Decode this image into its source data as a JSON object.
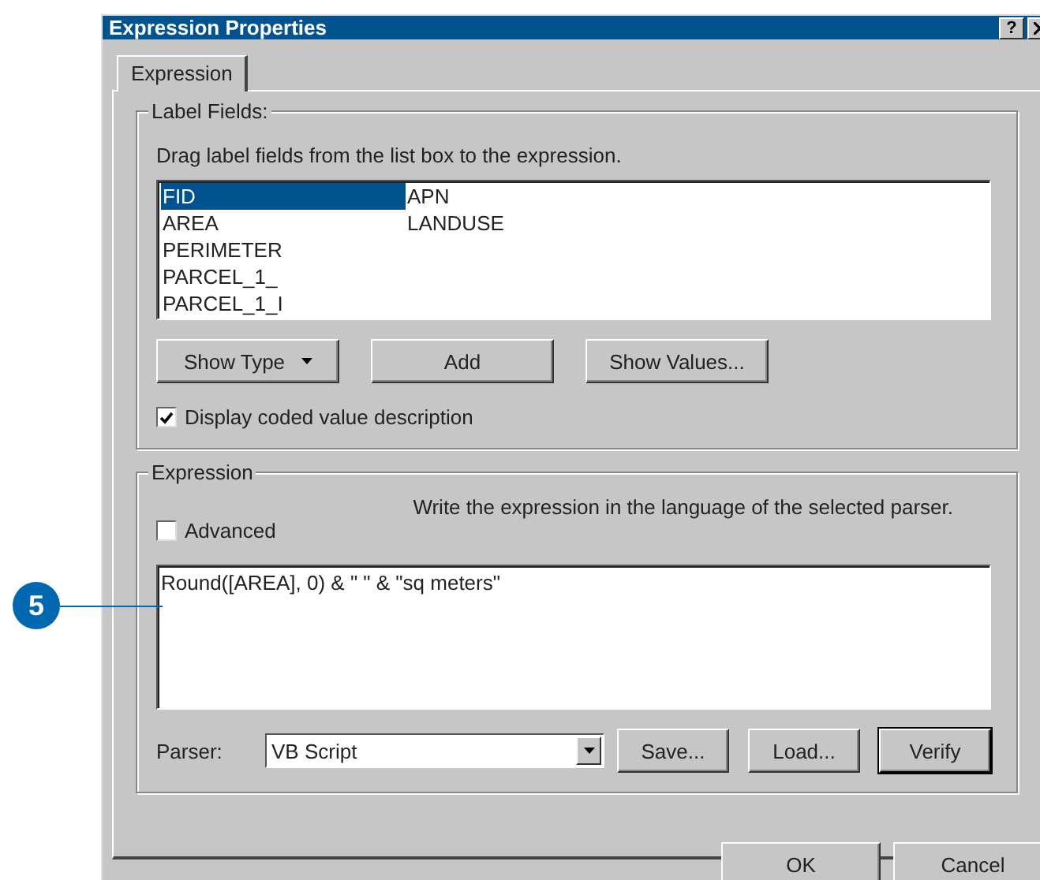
{
  "window": {
    "title": "Expression Properties",
    "help_button": "?"
  },
  "tabs": [
    {
      "label": "Expression",
      "selected": true
    }
  ],
  "label_fields": {
    "title": "Label Fields:",
    "instruction": "Drag label fields from the list box to the expression.",
    "fields": [
      {
        "label": "FID",
        "selected": true
      },
      {
        "label": "AREA",
        "selected": false
      },
      {
        "label": "PERIMETER",
        "selected": false
      },
      {
        "label": "PARCEL_1_",
        "selected": false
      },
      {
        "label": "PARCEL_1_I",
        "selected": false
      },
      {
        "label": "APN",
        "selected": false
      },
      {
        "label": "LANDUSE",
        "selected": false
      }
    ],
    "buttons": [
      {
        "label": "Show Type",
        "kind": "menu"
      },
      {
        "label": "Add",
        "kind": "plain"
      },
      {
        "label": "Show Values...",
        "kind": "plain"
      }
    ],
    "coded_values": {
      "label": "Display coded value description",
      "checked": true
    }
  },
  "expression": {
    "title": "Expression",
    "hint": "Write the expression in the language of the selected parser.",
    "advanced": {
      "label": "Advanced",
      "checked": false
    },
    "value": "Round([AREA], 0) & \" \" & \"sq meters\"",
    "parser_label": "Parser:",
    "parser": "VB Script",
    "buttons": [
      {
        "label": "Save...",
        "focused": false
      },
      {
        "label": "Load...",
        "focused": false
      },
      {
        "label": "Verify",
        "focused": true
      }
    ]
  },
  "dialog_buttons": [
    "OK",
    "Cancel"
  ],
  "callout": "5"
}
